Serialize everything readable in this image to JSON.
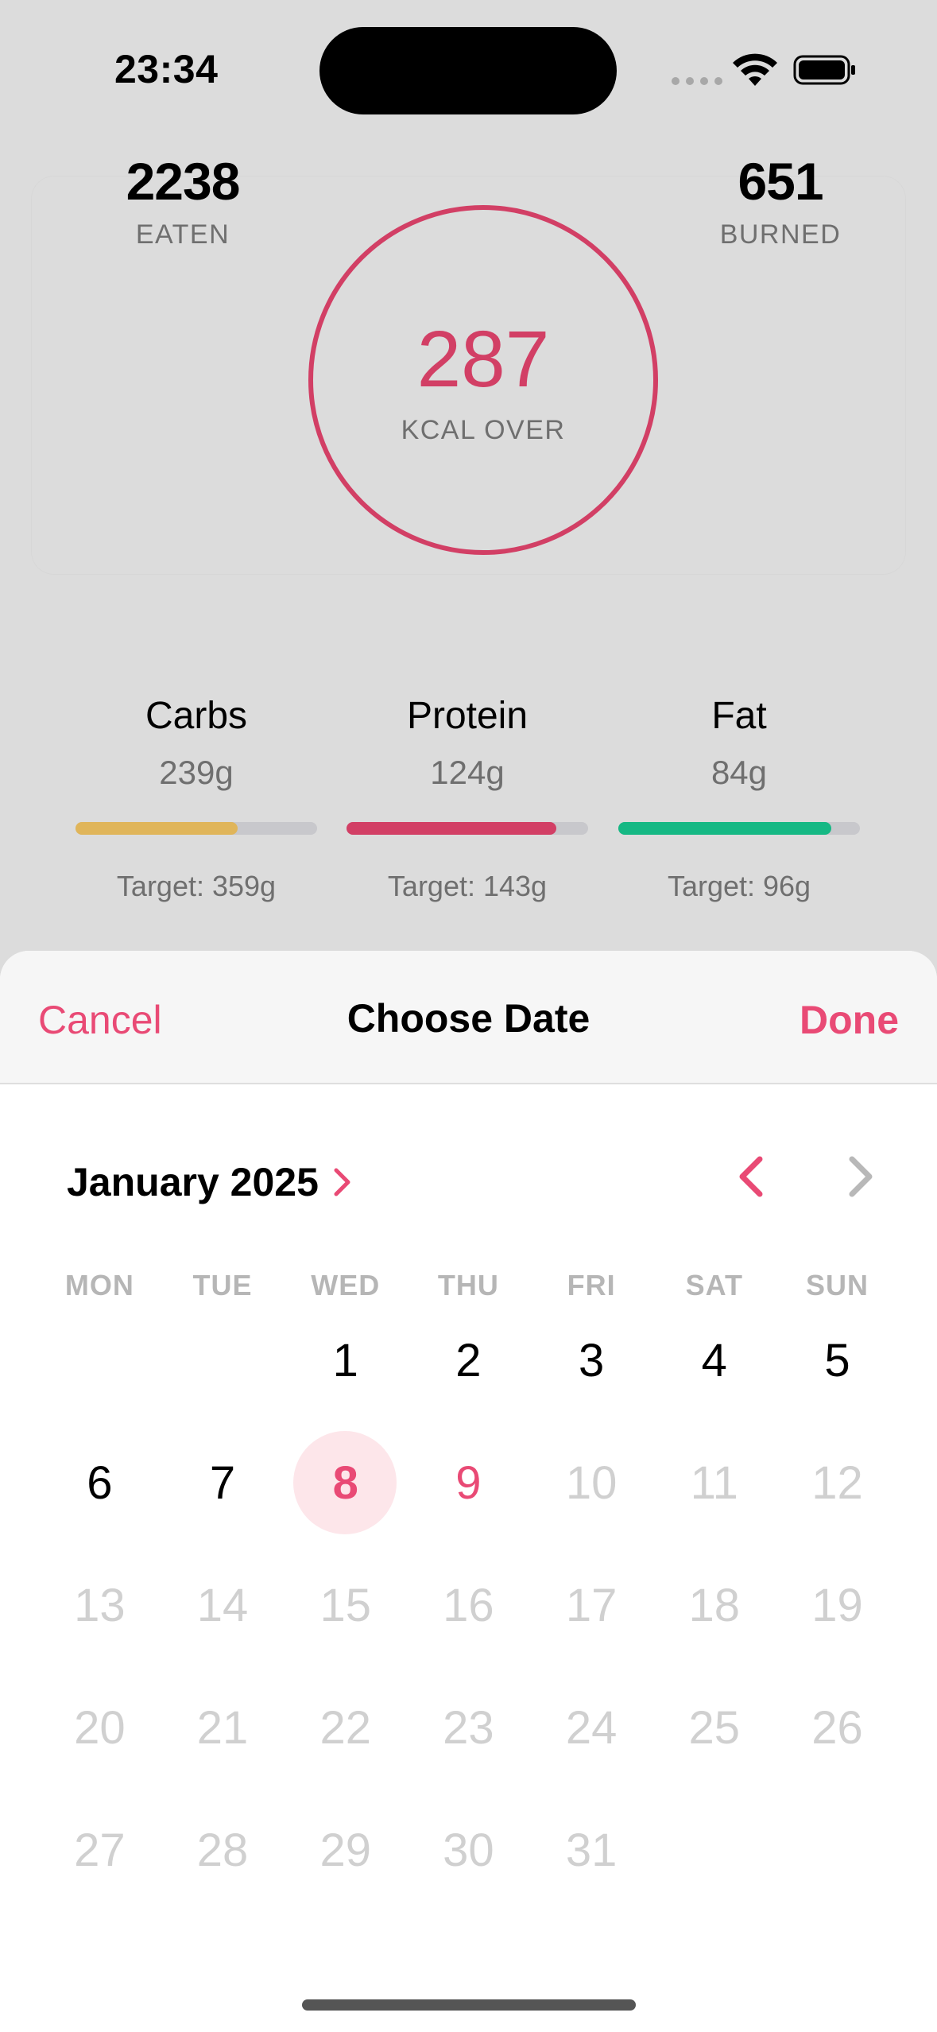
{
  "status": {
    "time": "23:34"
  },
  "summary": {
    "eaten_value": "2238",
    "eaten_label": "EATEN",
    "over_value": "287",
    "over_label": "KCAL OVER",
    "burned_value": "651",
    "burned_label": "BURNED"
  },
  "macros": [
    {
      "name": "Carbs",
      "amount": "239g",
      "target": "Target: 359g",
      "progress": 0.67,
      "color": "#e0b55a"
    },
    {
      "name": "Protein",
      "amount": "124g",
      "target": "Target: 143g",
      "progress": 0.87,
      "color": "#d23f65"
    },
    {
      "name": "Fat",
      "amount": "84g",
      "target": "Target: 96g",
      "progress": 0.88,
      "color": "#16b884"
    }
  ],
  "sheet": {
    "cancel_label": "Cancel",
    "title": "Choose Date",
    "done_label": "Done"
  },
  "calendar": {
    "month_label": "January 2025",
    "weekdays": [
      "MON",
      "TUE",
      "WED",
      "THU",
      "FRI",
      "SAT",
      "SUN"
    ],
    "leading_blanks": 2,
    "days_in_month": 31,
    "selected_day": 8,
    "today_day": 9,
    "last_enabled_day": 9,
    "accent": "#e94a75"
  }
}
